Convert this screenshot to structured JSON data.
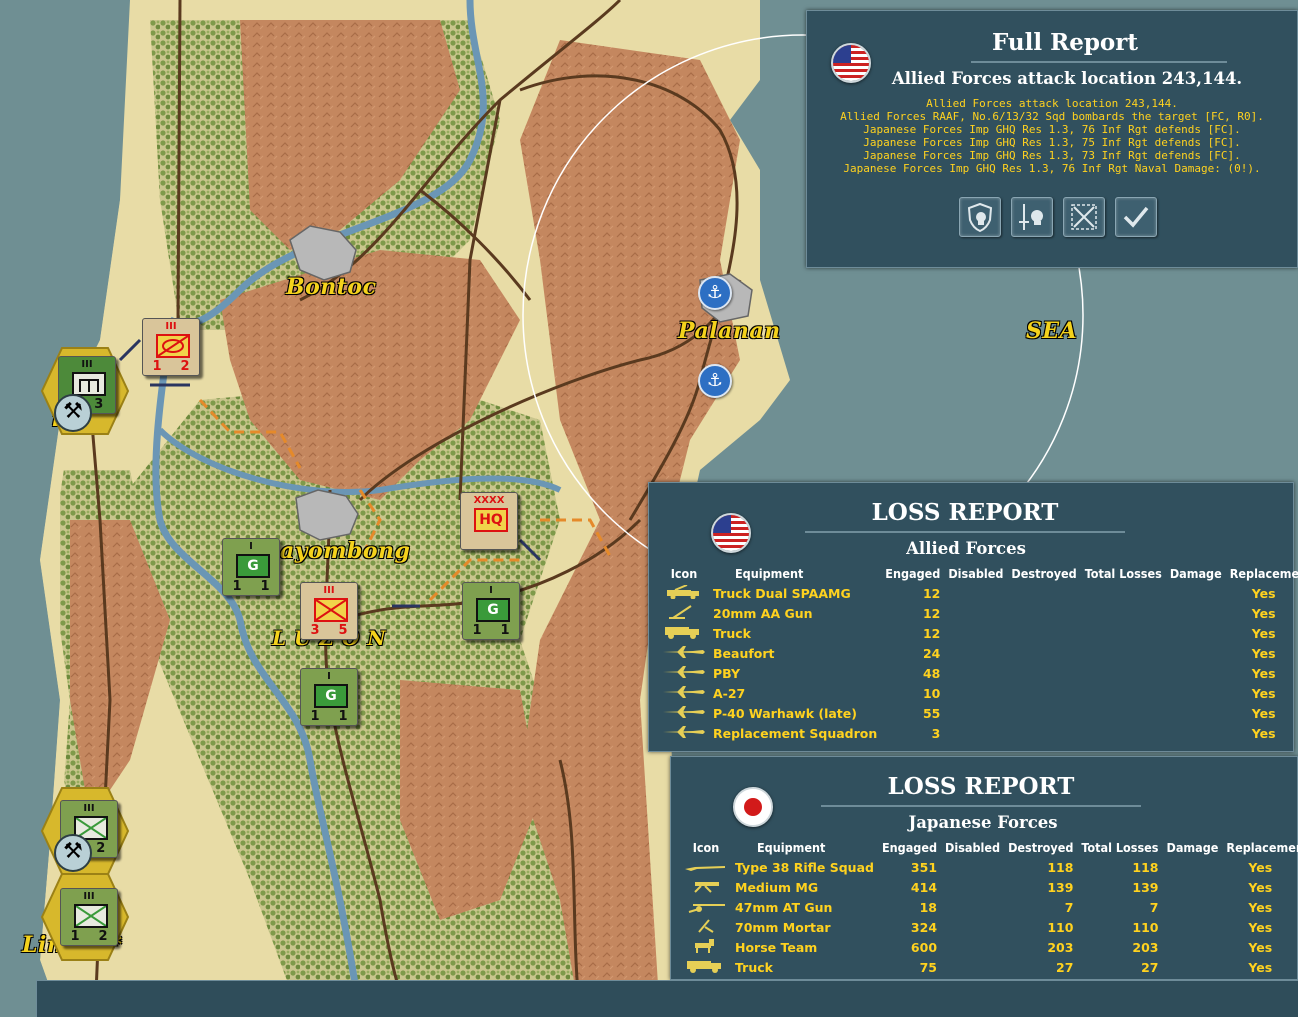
{
  "map": {
    "places": [
      {
        "id": "bontoc",
        "label": "Bontoc"
      },
      {
        "id": "palanan",
        "label": "Palanan"
      },
      {
        "id": "sea",
        "label": "SEA"
      },
      {
        "id": "bayombong",
        "label": "ayombong"
      },
      {
        "id": "luzon",
        "label": "L U Z O N"
      },
      {
        "id": "lingayen",
        "label": "Lin  en *"
      },
      {
        "id": "baguio",
        "label": "ig"
      }
    ],
    "counters": [
      {
        "id": "c1",
        "size": "III",
        "n1": "1",
        "n2": "2",
        "type": "tan-red-recon"
      },
      {
        "id": "c2",
        "size": "III",
        "n1": "",
        "n2": "3",
        "type": "green-hq-eng"
      },
      {
        "id": "c3",
        "size": "I",
        "letter": "G",
        "n1": "1",
        "n2": "1"
      },
      {
        "id": "c4",
        "size": "XXXX",
        "letter": "HQ",
        "n1": "",
        "n2": ""
      },
      {
        "id": "c5",
        "size": "III",
        "n1": "3",
        "n2": "5",
        "type": "tan-red-inf"
      },
      {
        "id": "c6",
        "size": "I",
        "letter": "G",
        "n1": "1",
        "n2": "1"
      },
      {
        "id": "c7",
        "size": "I",
        "letter": "G",
        "n1": "1",
        "n2": "1"
      },
      {
        "id": "c8",
        "size": "III",
        "n1": "",
        "n2": "2",
        "type": "green-inf"
      },
      {
        "id": "c9",
        "size": "III",
        "n1": "1",
        "n2": "2",
        "type": "green-inf"
      }
    ],
    "anchors": [
      "anchor",
      "anchor"
    ],
    "colors": {
      "sand": "#e8dca6",
      "forest": "#8a9a55",
      "hills": "#c08560",
      "sea": "#6f8f93",
      "road": "#5a3a1f",
      "river": "#6b96b5"
    }
  },
  "full_report": {
    "title": "Full Report",
    "subtitle": "Allied Forces attack location 243,144.",
    "log": [
      "Allied Forces attack location 243,144.",
      "Allied Forces RAAF, No.6/13/32 Sqd bombards the target [FC, R0].",
      "Japanese Forces Imp GHQ Res 1.3, 76 Inf Rgt defends [FC].",
      "Japanese Forces Imp GHQ Res 1.3, 75 Inf Rgt defends [FC].",
      "Japanese Forces Imp GHQ Res 1.3, 73 Inf Rgt defends [FC].",
      "Japanese Forces Imp GHQ Res 1.3, 76 Inf Rgt Naval Damage: (0!)."
    ],
    "buttons": [
      "shield-skull-icon",
      "sword-skull-icon",
      "crossed-hex-icon",
      "checkmark-icon"
    ]
  },
  "allied_loss": {
    "title": "LOSS REPORT",
    "side": "Allied Forces",
    "columns": [
      "Icon",
      "Equipment",
      "Engaged",
      "Disabled",
      "Destroyed",
      "Total Losses",
      "Damage",
      "Replacements"
    ],
    "rows": [
      {
        "icon": "truck-aa-icon",
        "equipment": "Truck Dual SPAAMG",
        "engaged": "12",
        "disabled": "",
        "destroyed": "",
        "total": "",
        "damage": "",
        "replacements": "Yes"
      },
      {
        "icon": "aa-gun-icon",
        "equipment": "20mm AA Gun",
        "engaged": "12",
        "disabled": "",
        "destroyed": "",
        "total": "",
        "damage": "",
        "replacements": "Yes"
      },
      {
        "icon": "truck-icon",
        "equipment": "Truck",
        "engaged": "12",
        "disabled": "",
        "destroyed": "",
        "total": "",
        "damage": "",
        "replacements": "Yes"
      },
      {
        "icon": "plane-icon",
        "equipment": "Beaufort",
        "engaged": "24",
        "disabled": "",
        "destroyed": "",
        "total": "",
        "damage": "",
        "replacements": "Yes"
      },
      {
        "icon": "plane-icon",
        "equipment": "PBY",
        "engaged": "48",
        "disabled": "",
        "destroyed": "",
        "total": "",
        "damage": "",
        "replacements": "Yes"
      },
      {
        "icon": "plane-icon",
        "equipment": "A-27",
        "engaged": "10",
        "disabled": "",
        "destroyed": "",
        "total": "",
        "damage": "",
        "replacements": "Yes"
      },
      {
        "icon": "plane-icon",
        "equipment": "P-40 Warhawk (late)",
        "engaged": "55",
        "disabled": "",
        "destroyed": "",
        "total": "",
        "damage": "",
        "replacements": "Yes"
      },
      {
        "icon": "plane-icon",
        "equipment": "Replacement Squadron",
        "engaged": "3",
        "disabled": "",
        "destroyed": "",
        "total": "",
        "damage": "",
        "replacements": "Yes"
      }
    ]
  },
  "japan_loss": {
    "title": "LOSS REPORT",
    "side": "Japanese Forces",
    "columns": [
      "Icon",
      "Equipment",
      "Engaged",
      "Disabled",
      "Destroyed",
      "Total Losses",
      "Damage",
      "Replacements"
    ],
    "rows": [
      {
        "icon": "rifle-icon",
        "equipment": "Type 38 Rifle Squad",
        "engaged": "351",
        "disabled": "",
        "destroyed": "118",
        "total": "118",
        "damage": "",
        "replacements": "Yes"
      },
      {
        "icon": "machine-gun-icon",
        "equipment": "Medium MG",
        "engaged": "414",
        "disabled": "",
        "destroyed": "139",
        "total": "139",
        "damage": "",
        "replacements": "Yes"
      },
      {
        "icon": "at-gun-icon",
        "equipment": "47mm AT Gun",
        "engaged": "18",
        "disabled": "",
        "destroyed": "7",
        "total": "7",
        "damage": "",
        "replacements": "Yes"
      },
      {
        "icon": "mortar-icon",
        "equipment": "70mm Mortar",
        "engaged": "324",
        "disabled": "",
        "destroyed": "110",
        "total": "110",
        "damage": "",
        "replacements": "Yes"
      },
      {
        "icon": "horse-icon",
        "equipment": "Horse Team",
        "engaged": "600",
        "disabled": "",
        "destroyed": "203",
        "total": "203",
        "damage": "",
        "replacements": "Yes"
      },
      {
        "icon": "truck-icon",
        "equipment": "Truck",
        "engaged": "75",
        "disabled": "",
        "destroyed": "27",
        "total": "27",
        "damage": "",
        "replacements": "Yes"
      }
    ]
  }
}
